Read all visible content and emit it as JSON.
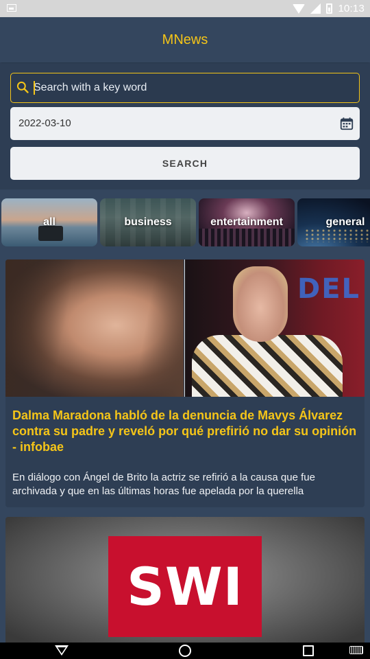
{
  "status_bar": {
    "time": "10:13"
  },
  "app_bar": {
    "title": "MNews"
  },
  "search": {
    "placeholder": "Search with a key word",
    "value": "",
    "date": "2022-03-10",
    "button_label": "SEARCH"
  },
  "categories": [
    {
      "label": "all"
    },
    {
      "label": "business"
    },
    {
      "label": "entertainment"
    },
    {
      "label": "general"
    }
  ],
  "articles": [
    {
      "title": "Dalma Maradona habló de la denuncia de Mavys Álvarez contra su padre y reveló por qué prefirió no dar su opinión - infobae",
      "description": "En diálogo con Ángel de Brito la actriz se refirió a la causa que fue archivada y que en las últimas horas fue apelada por la querella",
      "image_sign_text": "DEL"
    },
    {
      "image_logo_text": "SWI"
    }
  ],
  "colors": {
    "accent": "#f5c518",
    "background": "#34465e",
    "card": "#2e3e54"
  }
}
